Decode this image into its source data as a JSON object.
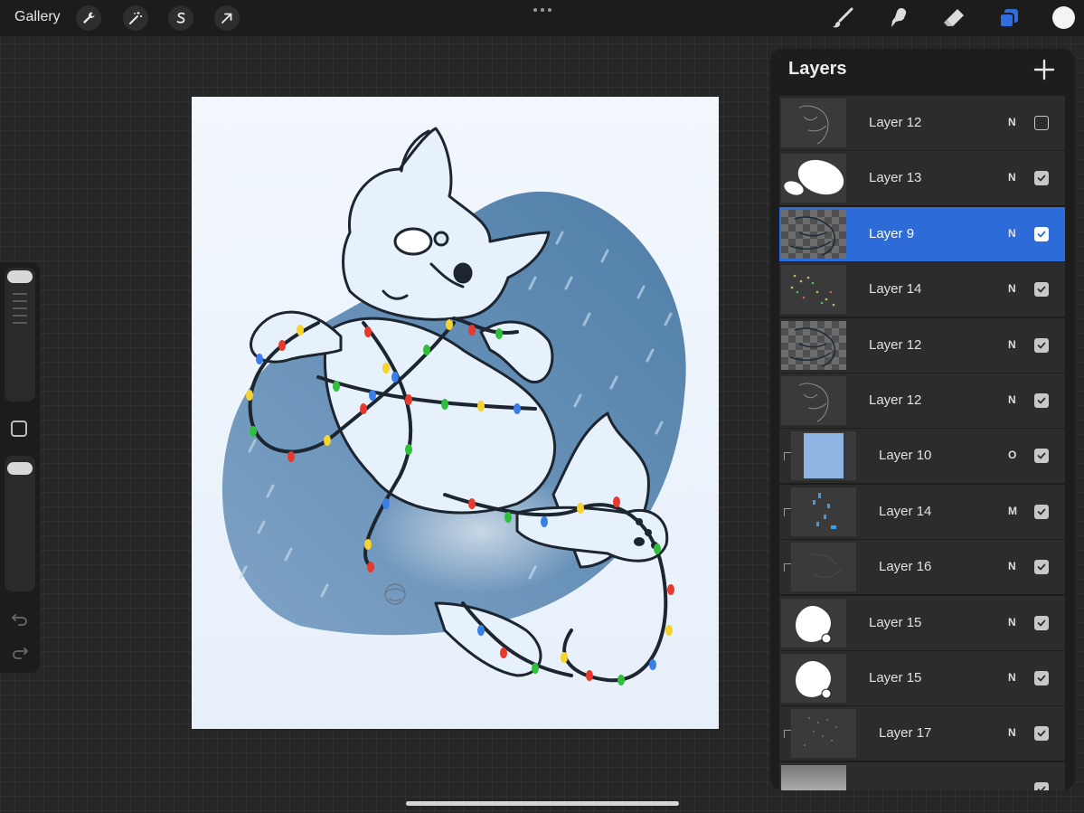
{
  "topbar": {
    "gallery_label": "Gallery",
    "tools_left": [
      {
        "name": "actions",
        "icon": "wrench-icon"
      },
      {
        "name": "adjustments",
        "icon": "magic-wand-icon"
      },
      {
        "name": "selection",
        "icon": "selection-s-icon"
      },
      {
        "name": "transform",
        "icon": "arrow-cursor-icon"
      }
    ],
    "more_icon": "more-dots-icon",
    "tools_right": [
      {
        "name": "brush",
        "icon": "brush-icon"
      },
      {
        "name": "smudge",
        "icon": "smudge-icon"
      },
      {
        "name": "eraser",
        "icon": "eraser-icon"
      },
      {
        "name": "layers",
        "icon": "layers-icon",
        "active": true,
        "color": "#2f6de0"
      }
    ],
    "current_color": "#f4f4f4"
  },
  "sidebar": {
    "brush_size": 0.98,
    "brush_opacity": 0.98,
    "modify_icon": "square-icon",
    "undo_icon": "undo-icon",
    "redo_icon": "redo-icon"
  },
  "canvas": {
    "background": "#eef4fb",
    "blob_color": "#5d88b1",
    "line_color": "#1c2530",
    "fur_color": "#e6f1fb",
    "light_colors": [
      "#e8392c",
      "#2fbf3a",
      "#f4d42d",
      "#3a7ee8"
    ]
  },
  "layers_panel": {
    "title": "Layers",
    "add_icon": "plus-icon",
    "layers": [
      {
        "name": "Layer 12",
        "blend": "N",
        "visible": false,
        "selected": false,
        "clipped": false,
        "thumb": "sketch"
      },
      {
        "name": "Layer 13",
        "blend": "N",
        "visible": true,
        "selected": false,
        "clipped": false,
        "thumb": "ovals"
      },
      {
        "name": "Layer 9",
        "blend": "N",
        "visible": true,
        "selected": true,
        "clipped": false,
        "thumb": "checker-lines"
      },
      {
        "name": "Layer 14",
        "blend": "N",
        "visible": true,
        "selected": false,
        "clipped": false,
        "thumb": "dots-lights"
      },
      {
        "name": "Layer 12",
        "blend": "N",
        "visible": true,
        "selected": false,
        "clipped": false,
        "thumb": "checker-lines"
      },
      {
        "name": "Layer 12",
        "blend": "N",
        "visible": true,
        "selected": false,
        "clipped": false,
        "thumb": "sketch"
      },
      {
        "name": "Layer 10",
        "blend": "O",
        "visible": true,
        "selected": false,
        "clipped": true,
        "thumb": "blue-fill"
      },
      {
        "name": "Layer 14",
        "blend": "M",
        "visible": true,
        "selected": false,
        "clipped": true,
        "thumb": "blue-dots"
      },
      {
        "name": "Layer 16",
        "blend": "N",
        "visible": true,
        "selected": false,
        "clipped": true,
        "thumb": "faint"
      },
      {
        "name": "Layer 15",
        "blend": "N",
        "visible": true,
        "selected": false,
        "clipped": false,
        "thumb": "white-shape"
      },
      {
        "name": "Layer 15",
        "blend": "N",
        "visible": true,
        "selected": false,
        "clipped": false,
        "thumb": "white-shape"
      },
      {
        "name": "Layer 17",
        "blend": "N",
        "visible": true,
        "selected": false,
        "clipped": true,
        "thumb": "specks"
      },
      {
        "name": "",
        "blend": "",
        "visible": true,
        "selected": false,
        "clipped": false,
        "thumb": "gradient"
      }
    ]
  }
}
